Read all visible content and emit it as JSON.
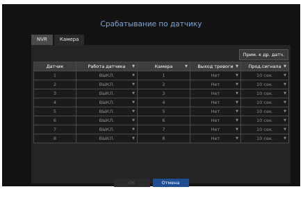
{
  "dialog": {
    "title": "Срабатывание по датчику"
  },
  "tabs": [
    "NVR",
    "Камера"
  ],
  "apply_button": "Прим. к др. датч.",
  "table": {
    "headers": [
      "Датчик",
      "Работа датчика",
      "Камера",
      "Выход тревоги",
      "Прод.сигнала"
    ],
    "rows": [
      [
        "1",
        "ВЫКЛ.",
        "1",
        "Нет",
        "10 сек."
      ],
      [
        "2",
        "ВЫКЛ.",
        "2",
        "Нет",
        "10 сек."
      ],
      [
        "3",
        "ВЫКЛ.",
        "3",
        "Нет",
        "10 сек."
      ],
      [
        "4",
        "ВЫКЛ.",
        "4",
        "Нет",
        "10 сек."
      ],
      [
        "5",
        "ВЫКЛ.",
        "5",
        "Нет",
        "10 сек."
      ],
      [
        "6",
        "ВЫКЛ.",
        "6",
        "Нет",
        "10 сек."
      ],
      [
        "7",
        "ВЫКЛ.",
        "7",
        "Нет",
        "10 сек."
      ],
      [
        "8",
        "ВЫКЛ.",
        "8",
        "Нет",
        "10 сек."
      ]
    ]
  },
  "footer": {
    "ok": "OK",
    "cancel": "Отмена"
  },
  "icons": {
    "dropdown": "▼"
  },
  "colors": {
    "title": "#7fa6d6",
    "cancel_bg": "#1f4d91",
    "active_tab": "#4a4a4a"
  }
}
